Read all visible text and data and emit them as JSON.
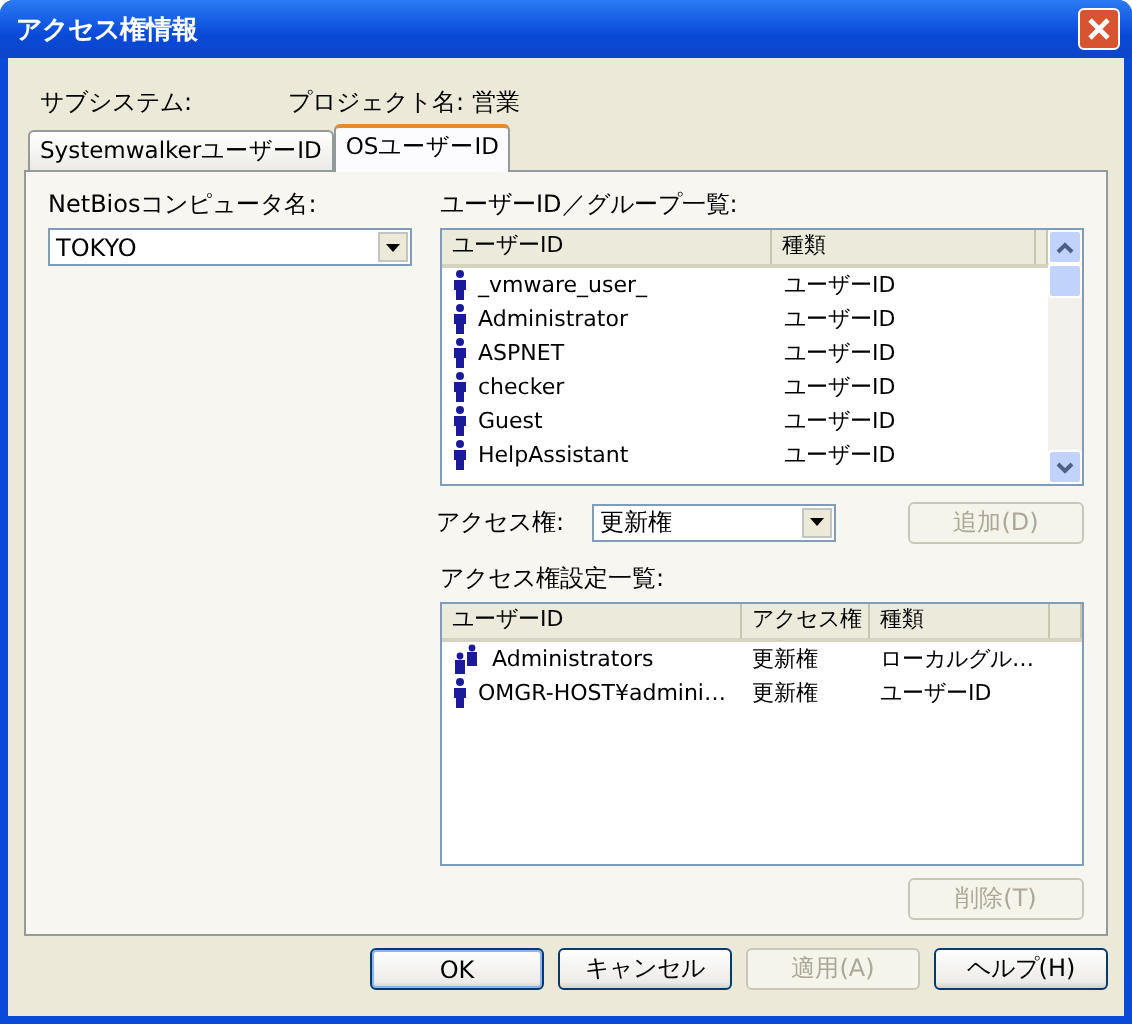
{
  "window": {
    "title": "アクセス権情報"
  },
  "info": {
    "subsystem_label": "サブシステム:",
    "project_label": "プロジェクト名:",
    "project_value": "営業"
  },
  "tabs": [
    {
      "label": "SystemwalkerユーザーID",
      "selected": false
    },
    {
      "label": "OSユーザーID",
      "selected": true
    }
  ],
  "netbios": {
    "label": "NetBiosコンピュータ名:",
    "value": "TOKYO"
  },
  "user_list": {
    "label": "ユーザーID／グループ一覧:",
    "columns": [
      "ユーザーID",
      "種類"
    ],
    "rows": [
      {
        "kind": "user",
        "name": "_vmware_user_",
        "type": "ユーザーID"
      },
      {
        "kind": "user",
        "name": "Administrator",
        "type": "ユーザーID"
      },
      {
        "kind": "user",
        "name": "ASPNET",
        "type": "ユーザーID"
      },
      {
        "kind": "user",
        "name": "checker",
        "type": "ユーザーID"
      },
      {
        "kind": "user",
        "name": "Guest",
        "type": "ユーザーID"
      },
      {
        "kind": "user",
        "name": "HelpAssistant",
        "type": "ユーザーID"
      }
    ]
  },
  "access": {
    "label": "アクセス権:",
    "value": "更新権",
    "add_button": {
      "label": "追加(D)",
      "disabled": true
    }
  },
  "settings_list": {
    "label": "アクセス権設定一覧:",
    "columns": [
      "ユーザーID",
      "アクセス権",
      "種類"
    ],
    "rows": [
      {
        "kind": "group",
        "name": "Administrators",
        "access": "更新権",
        "type": "ローカルグル…"
      },
      {
        "kind": "user",
        "name": "OMGR-HOST¥admini…",
        "access": "更新権",
        "type": "ユーザーID"
      }
    ]
  },
  "delete_button": {
    "label": "削除(T)",
    "disabled": true
  },
  "buttons": [
    {
      "label": "OK",
      "disabled": false,
      "default": true
    },
    {
      "label": "キャンセル",
      "disabled": false,
      "default": false
    },
    {
      "label": "適用(A)",
      "disabled": true,
      "default": false
    },
    {
      "label": "ヘルプ(H)",
      "disabled": false,
      "default": false
    }
  ]
}
